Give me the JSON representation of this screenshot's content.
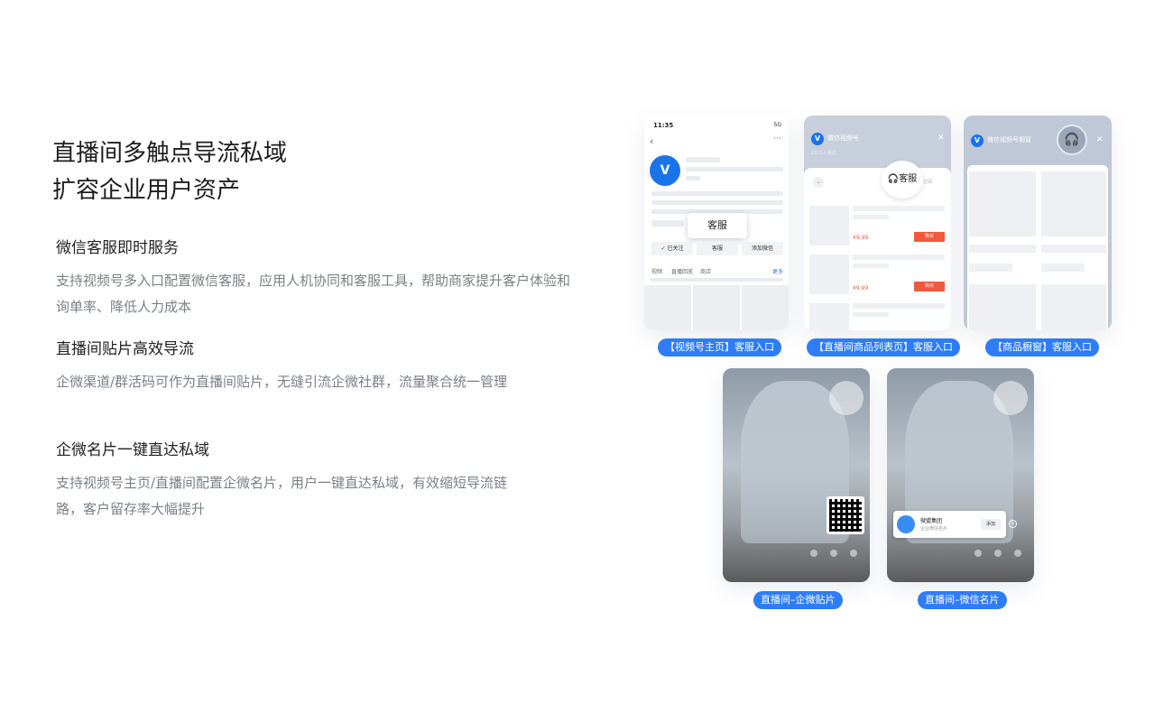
{
  "headline": {
    "line1": "直播间多触点导流私域",
    "line2": "扩容企业用户资产"
  },
  "features": [
    {
      "title": "微信客服即时服务",
      "desc": "支持视频号多入口配置微信客服，应用人机协同和客服工具，帮助商家提升客户体验和询单率、降低人力成本"
    },
    {
      "title": "直播间贴片高效导流",
      "desc": "企微渠道/群活码可作为直播间贴片，无缝引流企微社群，流量聚合统一管理"
    },
    {
      "title": "企微名片一键直达私域",
      "desc": "支持视频号主页/直播间配置企微名片，用户一键直达私域，有效缩短导流链路，客户留存率大幅提升"
    }
  ],
  "cards": {
    "channel_home": {
      "time": "11:35",
      "signal": "5G",
      "popup": "客服",
      "follow": "✓ 已关注",
      "service": "客服",
      "add_wechat": "添加微信",
      "tabs": [
        "视频",
        "直播回放",
        "商店"
      ],
      "more": "更多",
      "caption": "【视频号主页】客服入口"
    },
    "product_list": {
      "title": "微信视频号",
      "subtitle": "2373人看过",
      "service_bubble": "客服",
      "subscribe": "订阅",
      "price": "¥9.99",
      "buy": "购买",
      "caption": "【直播间商品列表页】客服入口"
    },
    "product_window": {
      "title": "微信视频号橱窗",
      "caption": "【商品橱窗】客服入口"
    },
    "live_sticker": {
      "caption": "直播间–企微贴片"
    },
    "live_card": {
      "card_name": "微盟集团",
      "card_sub": "企业微信名片",
      "add": "添加",
      "caption": "直播间–微信名片"
    }
  },
  "colors": {
    "accent": "#2f7df6",
    "buy": "#f05a3a",
    "desc_text": "#7b7f86"
  }
}
